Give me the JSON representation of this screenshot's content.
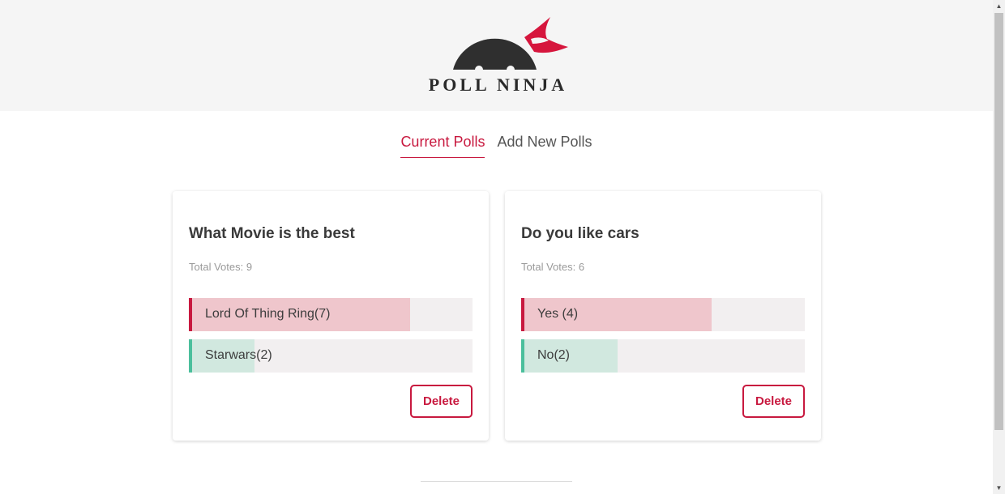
{
  "app": {
    "logo_text": "POLL NINJA",
    "accent_color": "#c8193f",
    "secondary_color": "#4bbf9c"
  },
  "nav": {
    "tabs": [
      {
        "label": "Current Polls",
        "active": true
      },
      {
        "label": "Add New Polls",
        "active": false
      }
    ]
  },
  "polls": [
    {
      "title": "What Movie is the best",
      "total_votes": "Total Votes: 9",
      "options": [
        {
          "label": "Lord Of Thing Ring(7)",
          "votes": 7,
          "color": "red"
        },
        {
          "label": "Starwars(2)",
          "votes": 2,
          "color": "green"
        }
      ],
      "delete_label": "Delete"
    },
    {
      "title": "Do you like cars",
      "total_votes": "Total Votes: 6",
      "options": [
        {
          "label": "Yes (4)",
          "votes": 4,
          "color": "red"
        },
        {
          "label": "No(2)",
          "votes": 2,
          "color": "green"
        }
      ],
      "delete_label": "Delete"
    }
  ],
  "icons": {
    "logo": "ninja-logo-icon",
    "scroll_up": "scroll-up-arrow-icon",
    "scroll_down": "scroll-down-arrow-icon"
  }
}
